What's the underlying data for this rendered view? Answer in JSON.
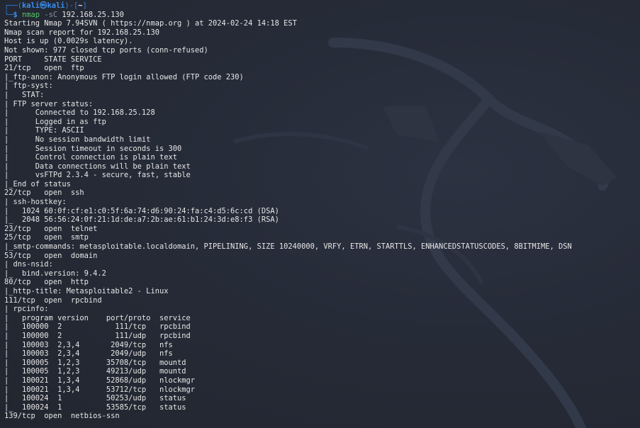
{
  "prompt": {
    "corner_top": "┌──(",
    "user": "kali㉿kali",
    "mid": ")-[",
    "dir": "~",
    "end": "]",
    "corner_bottom": "└─",
    "dollar": "$ ",
    "command": "nmap",
    "flag": " -sC",
    "target": " 192.168.25.130"
  },
  "output_lines": [
    "Starting Nmap 7.94SVN ( https://nmap.org ) at 2024-02-24 14:18 EST",
    "Nmap scan report for 192.168.25.130",
    "Host is up (0.0029s latency).",
    "Not shown: 977 closed tcp ports (conn-refused)",
    "PORT     STATE SERVICE",
    "21/tcp   open  ftp",
    "|_ftp-anon: Anonymous FTP login allowed (FTP code 230)",
    "| ftp-syst:",
    "|   STAT:",
    "| FTP server status:",
    "|      Connected to 192.168.25.128",
    "|      Logged in as ftp",
    "|      TYPE: ASCII",
    "|      No session bandwidth limit",
    "|      Session timeout in seconds is 300",
    "|      Control connection is plain text",
    "|      Data connections will be plain text",
    "|      vsFTPd 2.3.4 - secure, fast, stable",
    "|_End of status",
    "22/tcp   open  ssh",
    "| ssh-hostkey:",
    "|   1024 60:0f:cf:e1:c0:5f:6a:74:d6:90:24:fa:c4:d5:6c:cd (DSA)",
    "|_  2048 56:56:24:0f:21:1d:de:a7:2b:ae:61:b1:24:3d:e8:f3 (RSA)",
    "23/tcp   open  telnet",
    "25/tcp   open  smtp",
    "|_smtp-commands: metasploitable.localdomain, PIPELINING, SIZE 10240000, VRFY, ETRN, STARTTLS, ENHANCEDSTATUSCODES, 8BITMIME, DSN",
    "53/tcp   open  domain",
    "| dns-nsid:",
    "|_  bind.version: 9.4.2",
    "80/tcp   open  http",
    "|_http-title: Metasploitable2 - Linux",
    "111/tcp  open  rpcbind",
    "| rpcinfo:",
    "|   program version    port/proto  service",
    "|   100000  2            111/tcp   rpcbind",
    "|   100000  2            111/udp   rpcbind",
    "|   100003  2,3,4       2049/tcp   nfs",
    "|   100003  2,3,4       2049/udp   nfs",
    "|   100005  1,2,3      35708/tcp   mountd",
    "|   100005  1,2,3      49213/udp   mountd",
    "|   100021  1,3,4      52868/udp   nlockmgr",
    "|   100021  1,3,4      53712/tcp   nlockmgr",
    "|   100024  1          50253/udp   status",
    "|_  100024  1          53585/tcp   status",
    "139/tcp  open  netbios-ssn"
  ],
  "colors": {
    "background": "#252a36",
    "prompt_blue": "#2f7ddb",
    "command_green": "#56c46a",
    "text": "#e6e6e6"
  }
}
